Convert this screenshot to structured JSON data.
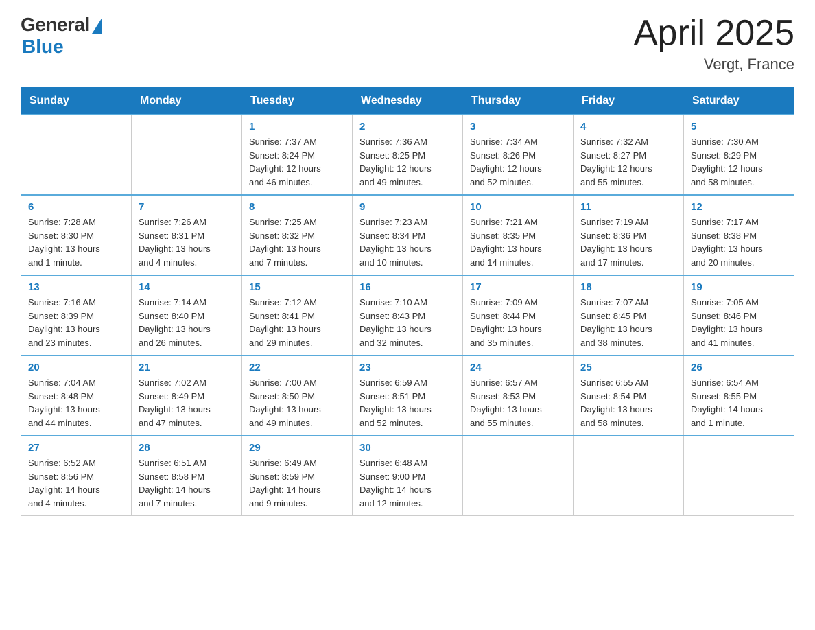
{
  "header": {
    "logo": {
      "general": "General",
      "blue": "Blue"
    },
    "title": "April 2025",
    "location": "Vergt, France"
  },
  "days_of_week": [
    "Sunday",
    "Monday",
    "Tuesday",
    "Wednesday",
    "Thursday",
    "Friday",
    "Saturday"
  ],
  "weeks": [
    [
      {
        "day": "",
        "info": ""
      },
      {
        "day": "",
        "info": ""
      },
      {
        "day": "1",
        "info": "Sunrise: 7:37 AM\nSunset: 8:24 PM\nDaylight: 12 hours\nand 46 minutes."
      },
      {
        "day": "2",
        "info": "Sunrise: 7:36 AM\nSunset: 8:25 PM\nDaylight: 12 hours\nand 49 minutes."
      },
      {
        "day": "3",
        "info": "Sunrise: 7:34 AM\nSunset: 8:26 PM\nDaylight: 12 hours\nand 52 minutes."
      },
      {
        "day": "4",
        "info": "Sunrise: 7:32 AM\nSunset: 8:27 PM\nDaylight: 12 hours\nand 55 minutes."
      },
      {
        "day": "5",
        "info": "Sunrise: 7:30 AM\nSunset: 8:29 PM\nDaylight: 12 hours\nand 58 minutes."
      }
    ],
    [
      {
        "day": "6",
        "info": "Sunrise: 7:28 AM\nSunset: 8:30 PM\nDaylight: 13 hours\nand 1 minute."
      },
      {
        "day": "7",
        "info": "Sunrise: 7:26 AM\nSunset: 8:31 PM\nDaylight: 13 hours\nand 4 minutes."
      },
      {
        "day": "8",
        "info": "Sunrise: 7:25 AM\nSunset: 8:32 PM\nDaylight: 13 hours\nand 7 minutes."
      },
      {
        "day": "9",
        "info": "Sunrise: 7:23 AM\nSunset: 8:34 PM\nDaylight: 13 hours\nand 10 minutes."
      },
      {
        "day": "10",
        "info": "Sunrise: 7:21 AM\nSunset: 8:35 PM\nDaylight: 13 hours\nand 14 minutes."
      },
      {
        "day": "11",
        "info": "Sunrise: 7:19 AM\nSunset: 8:36 PM\nDaylight: 13 hours\nand 17 minutes."
      },
      {
        "day": "12",
        "info": "Sunrise: 7:17 AM\nSunset: 8:38 PM\nDaylight: 13 hours\nand 20 minutes."
      }
    ],
    [
      {
        "day": "13",
        "info": "Sunrise: 7:16 AM\nSunset: 8:39 PM\nDaylight: 13 hours\nand 23 minutes."
      },
      {
        "day": "14",
        "info": "Sunrise: 7:14 AM\nSunset: 8:40 PM\nDaylight: 13 hours\nand 26 minutes."
      },
      {
        "day": "15",
        "info": "Sunrise: 7:12 AM\nSunset: 8:41 PM\nDaylight: 13 hours\nand 29 minutes."
      },
      {
        "day": "16",
        "info": "Sunrise: 7:10 AM\nSunset: 8:43 PM\nDaylight: 13 hours\nand 32 minutes."
      },
      {
        "day": "17",
        "info": "Sunrise: 7:09 AM\nSunset: 8:44 PM\nDaylight: 13 hours\nand 35 minutes."
      },
      {
        "day": "18",
        "info": "Sunrise: 7:07 AM\nSunset: 8:45 PM\nDaylight: 13 hours\nand 38 minutes."
      },
      {
        "day": "19",
        "info": "Sunrise: 7:05 AM\nSunset: 8:46 PM\nDaylight: 13 hours\nand 41 minutes."
      }
    ],
    [
      {
        "day": "20",
        "info": "Sunrise: 7:04 AM\nSunset: 8:48 PM\nDaylight: 13 hours\nand 44 minutes."
      },
      {
        "day": "21",
        "info": "Sunrise: 7:02 AM\nSunset: 8:49 PM\nDaylight: 13 hours\nand 47 minutes."
      },
      {
        "day": "22",
        "info": "Sunrise: 7:00 AM\nSunset: 8:50 PM\nDaylight: 13 hours\nand 49 minutes."
      },
      {
        "day": "23",
        "info": "Sunrise: 6:59 AM\nSunset: 8:51 PM\nDaylight: 13 hours\nand 52 minutes."
      },
      {
        "day": "24",
        "info": "Sunrise: 6:57 AM\nSunset: 8:53 PM\nDaylight: 13 hours\nand 55 minutes."
      },
      {
        "day": "25",
        "info": "Sunrise: 6:55 AM\nSunset: 8:54 PM\nDaylight: 13 hours\nand 58 minutes."
      },
      {
        "day": "26",
        "info": "Sunrise: 6:54 AM\nSunset: 8:55 PM\nDaylight: 14 hours\nand 1 minute."
      }
    ],
    [
      {
        "day": "27",
        "info": "Sunrise: 6:52 AM\nSunset: 8:56 PM\nDaylight: 14 hours\nand 4 minutes."
      },
      {
        "day": "28",
        "info": "Sunrise: 6:51 AM\nSunset: 8:58 PM\nDaylight: 14 hours\nand 7 minutes."
      },
      {
        "day": "29",
        "info": "Sunrise: 6:49 AM\nSunset: 8:59 PM\nDaylight: 14 hours\nand 9 minutes."
      },
      {
        "day": "30",
        "info": "Sunrise: 6:48 AM\nSunset: 9:00 PM\nDaylight: 14 hours\nand 12 minutes."
      },
      {
        "day": "",
        "info": ""
      },
      {
        "day": "",
        "info": ""
      },
      {
        "day": "",
        "info": ""
      }
    ]
  ]
}
